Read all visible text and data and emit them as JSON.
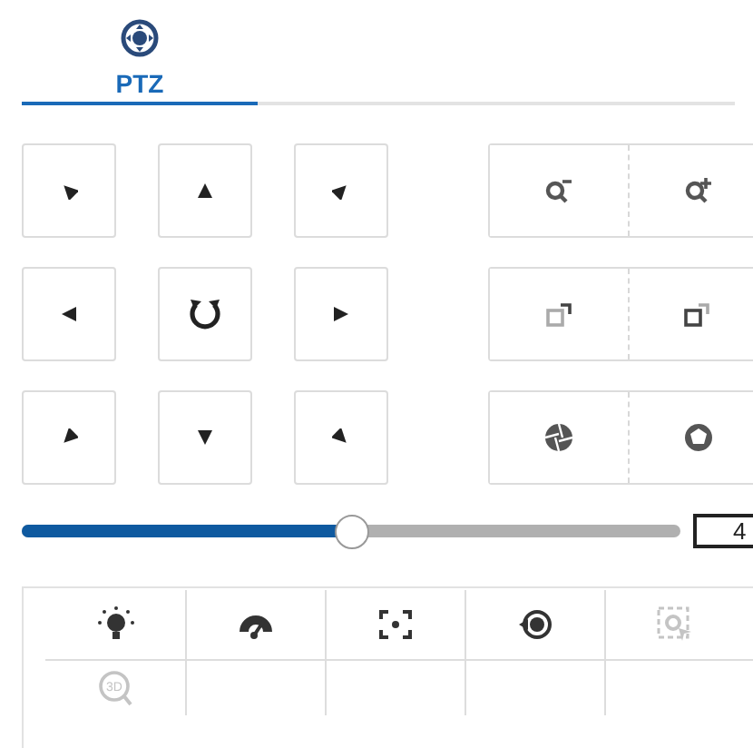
{
  "tabs": [
    {
      "label": "PTZ",
      "selected": true
    }
  ],
  "pad": [
    {
      "kind": "arrow"
    },
    {
      "kind": "arrow"
    },
    {
      "kind": "arrow"
    },
    {
      "kind": "arrow"
    },
    {
      "kind": "auto"
    },
    {
      "kind": "arrow"
    },
    {
      "kind": "arrow"
    },
    {
      "kind": "arrow"
    },
    {
      "kind": "arrow"
    }
  ],
  "lens": [
    {
      "kind": "zoom"
    },
    {
      "kind": "focus"
    },
    {
      "kind": "iris"
    }
  ],
  "speed": {
    "level": 0.5,
    "value": "4"
  },
  "toolbar": [
    {
      "kind": "light",
      "disabled": false
    },
    {
      "kind": "wiper",
      "disabled": false
    },
    {
      "kind": "focus",
      "disabled": false
    },
    {
      "kind": "reset",
      "disabled": false
    },
    {
      "kind": "track",
      "disabled": true
    },
    {
      "kind": "zoom3d",
      "disabled": true,
      "label": "3D"
    }
  ]
}
